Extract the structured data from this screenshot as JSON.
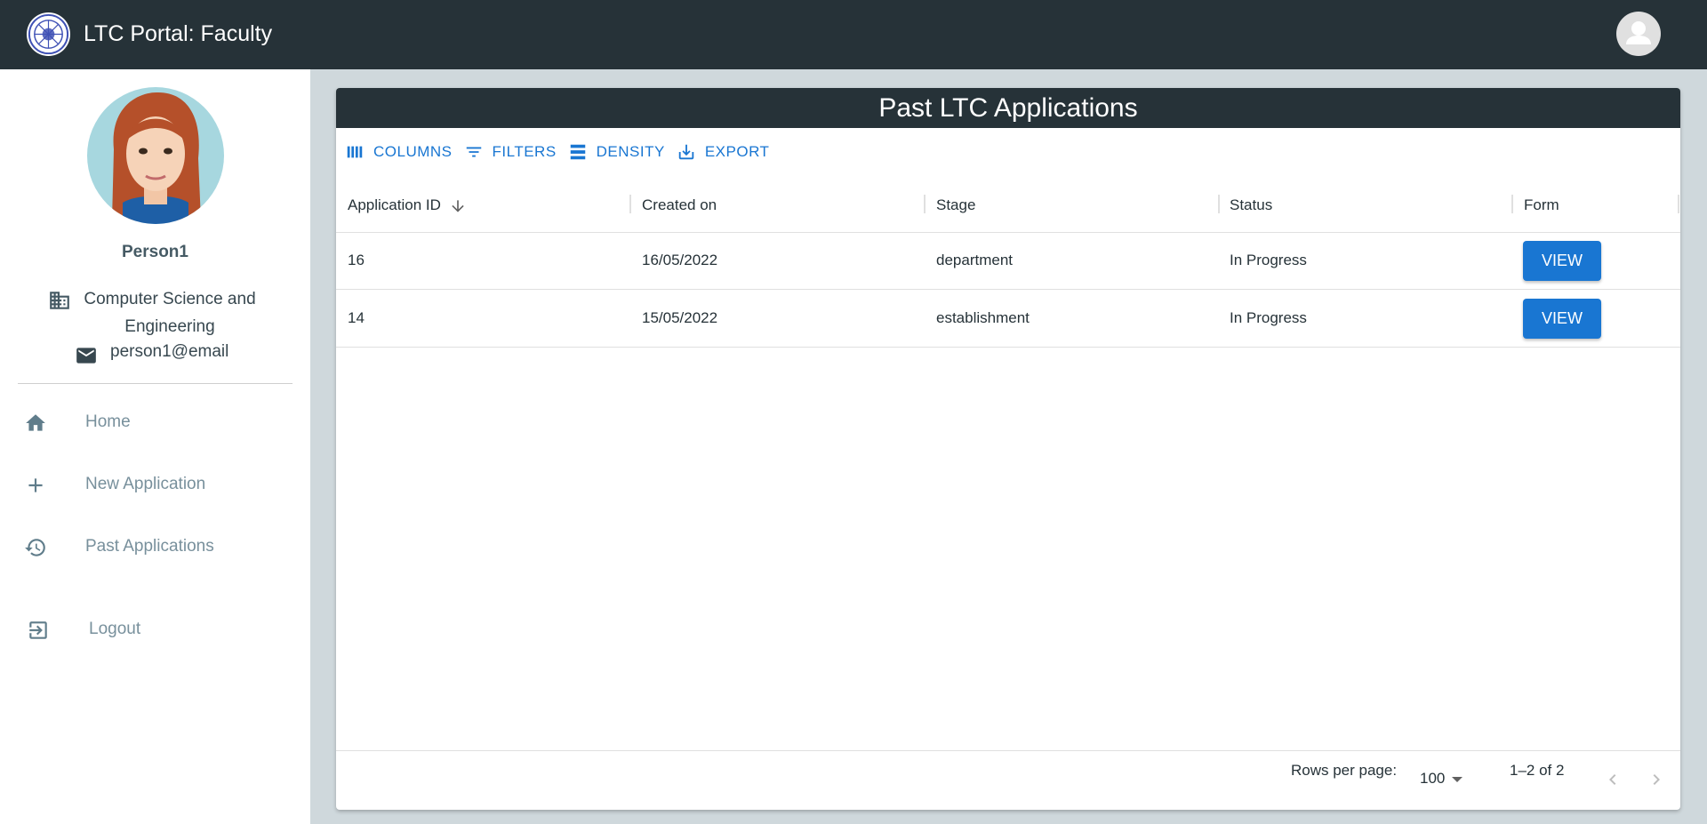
{
  "app": {
    "title": "LTC Portal: Faculty",
    "colors": {
      "appbar": "#263238",
      "primary": "#1976d2",
      "background": "#cfd8dc"
    }
  },
  "profile": {
    "name": "Person1",
    "department": "Computer Science and Engineering",
    "email": "person1@email"
  },
  "nav": {
    "home": "Home",
    "new_application": "New Application",
    "past_applications": "Past Applications",
    "logout": "Logout"
  },
  "card": {
    "title": "Past LTC Applications"
  },
  "toolbar": {
    "columns": "COLUMNS",
    "filters": "FILTERS",
    "density": "DENSITY",
    "export": "EXPORT"
  },
  "table": {
    "columns": {
      "application_id": "Application ID",
      "created_on": "Created on",
      "stage": "Stage",
      "status": "Status",
      "form": "Form"
    },
    "sort": {
      "column": "Application ID",
      "direction": "descending"
    },
    "rows": [
      {
        "id": "16",
        "created_on": "16/05/2022",
        "stage": "department",
        "status": "In Progress",
        "action": "VIEW"
      },
      {
        "id": "14",
        "created_on": "15/05/2022",
        "stage": "establishment",
        "status": "In Progress",
        "action": "VIEW"
      }
    ]
  },
  "pagination": {
    "rows_per_page_label": "Rows per page:",
    "rows_per_page_value": "100",
    "range": "1–2 of 2"
  }
}
